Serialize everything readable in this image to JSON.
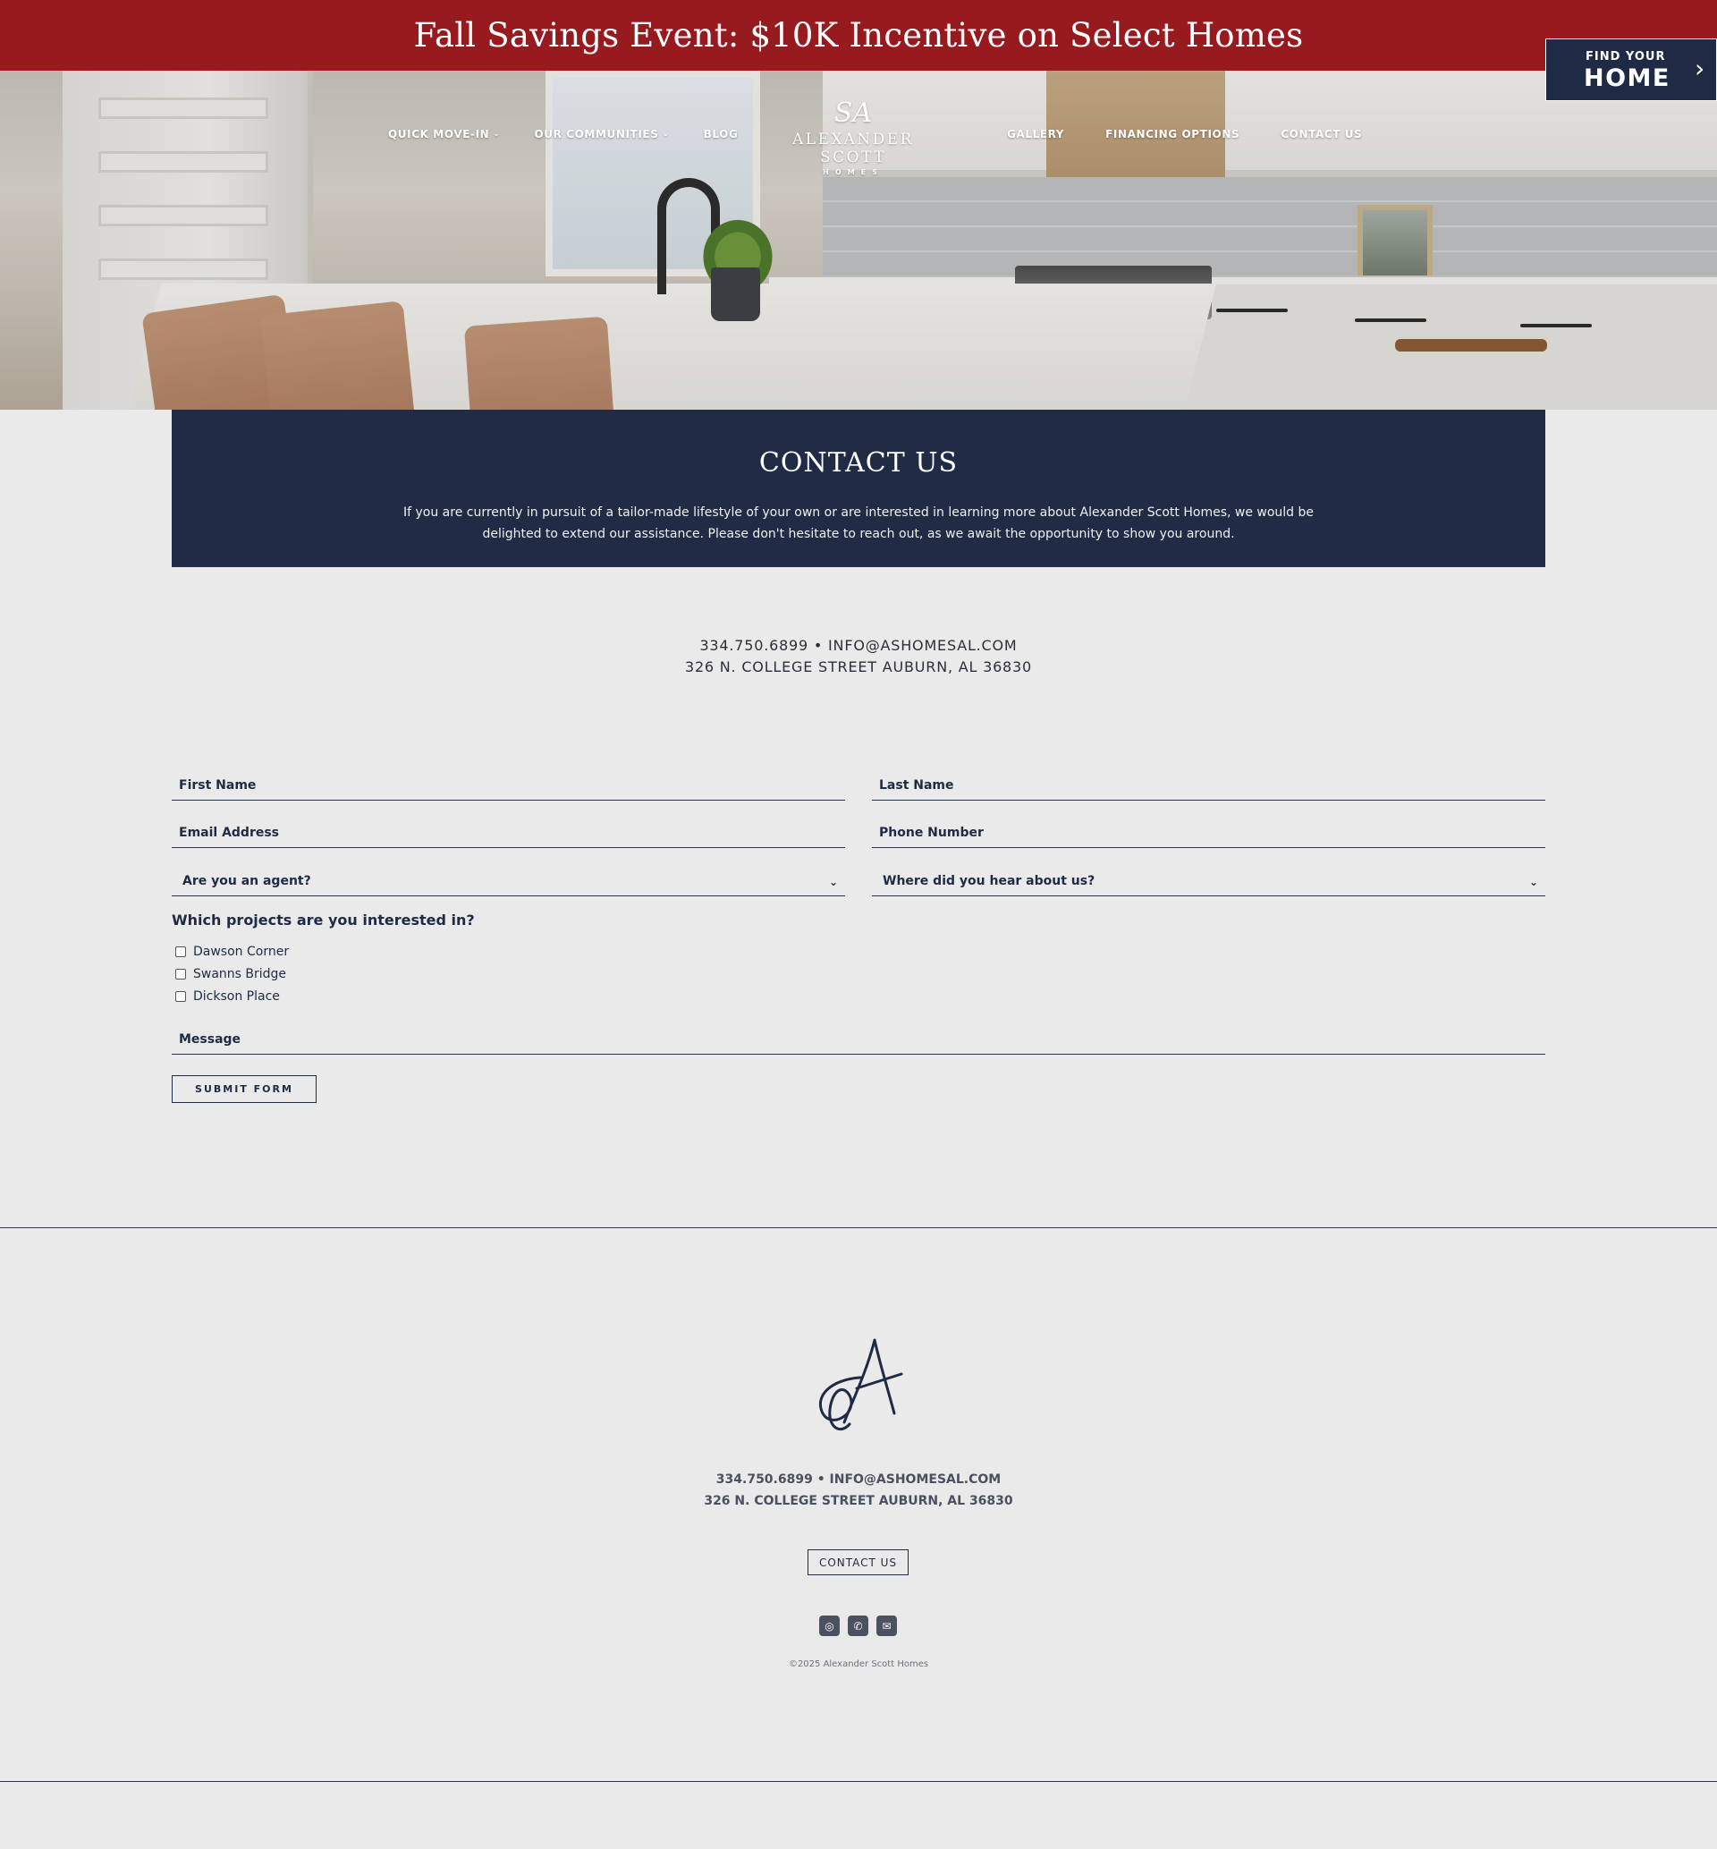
{
  "promo": {
    "text": "Fall Savings Event: $10K Incentive on Select Homes"
  },
  "nav": {
    "left": [
      {
        "label": "QUICK MOVE-IN",
        "dropdown": true
      },
      {
        "label": "OUR COMMUNITIES",
        "dropdown": true
      },
      {
        "label": "BLOG",
        "dropdown": false
      }
    ],
    "right": [
      {
        "label": "GALLERY"
      },
      {
        "label": "FINANCING OPTIONS"
      },
      {
        "label": "CONTACT US"
      }
    ],
    "logo": {
      "mark": "SA",
      "name": "ALEXANDER SCOTT",
      "sub": "HOMES"
    }
  },
  "find_home": {
    "small": "FIND YOUR",
    "big": "HOME",
    "icon": "chevron-right-icon"
  },
  "contact_header": {
    "title": "CONTACT US",
    "body": "If you are currently in pursuit of a tailor-made lifestyle of your own or are interested in learning more about Alexander Scott Homes, we would be delighted to extend our assistance. Please don't hesitate to reach out, as we await the opportunity to show you around."
  },
  "contact_info": {
    "line1": "334.750.6899 • INFO@ASHOMESAL.COM",
    "line2": "326 N. COLLEGE STREET AUBURN, AL 36830"
  },
  "form": {
    "first_name": {
      "placeholder": "First Name",
      "value": ""
    },
    "last_name": {
      "placeholder": "Last Name",
      "value": ""
    },
    "email": {
      "placeholder": "Email Address",
      "value": ""
    },
    "phone": {
      "placeholder": "Phone Number",
      "value": ""
    },
    "agent_select": {
      "selected": "Are you an agent?"
    },
    "source_select": {
      "selected": "Where did you hear about us?"
    },
    "projects_label": "Which projects are you interested in?",
    "projects": [
      {
        "label": "Dawson Corner",
        "checked": false
      },
      {
        "label": "Swanns Bridge",
        "checked": false
      },
      {
        "label": "Dickson Place",
        "checked": false
      }
    ],
    "message": {
      "placeholder": "Message",
      "value": ""
    },
    "submit_label": "SUBMIT FORM"
  },
  "footer": {
    "line1": "334.750.6899 • INFO@ASHOMESAL.COM",
    "line2": "326 N. COLLEGE STREET AUBURN, AL 36830",
    "contact_button": "CONTACT US",
    "social": [
      {
        "icon": "instagram-icon",
        "glyph": "◎"
      },
      {
        "icon": "phone-icon",
        "glyph": "✆"
      },
      {
        "icon": "mail-icon",
        "glyph": "✉"
      }
    ],
    "copyright": "©2025 Alexander Scott Homes"
  },
  "colors": {
    "promo": "#961a1e",
    "navy": "#202b45",
    "page_bg": "#eaeaea"
  }
}
